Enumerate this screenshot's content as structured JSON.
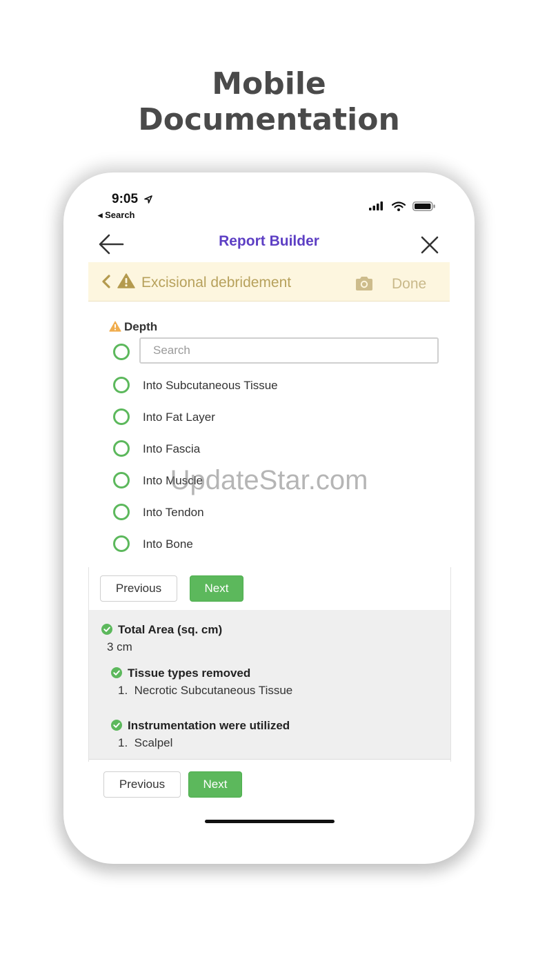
{
  "headline": {
    "line1": "Mobile",
    "line2": "Documentation"
  },
  "status_bar": {
    "time": "9:05",
    "back_label": "◂ Search"
  },
  "nav": {
    "title": "Report Builder"
  },
  "banner": {
    "title": "Excisional debridement",
    "done_label": "Done"
  },
  "depth": {
    "label": "Depth",
    "search_placeholder": "Search",
    "options": [
      "Into Subcutaneous Tissue",
      "Into Fat Layer",
      "Into Fascia",
      "Into Muscle",
      "Into Tendon",
      "Into Bone"
    ]
  },
  "buttons": {
    "previous": "Previous",
    "next": "Next"
  },
  "summary": {
    "items": [
      {
        "title": "Total Area (sq. cm)",
        "value": "3 cm"
      },
      {
        "title": "Tissue types removed",
        "value": "1.  Necrotic Subcutaneous Tissue"
      },
      {
        "title": "Instrumentation were utilized",
        "value": "1.  Scalpel"
      }
    ]
  },
  "watermark": "UpdateStar.com",
  "colors": {
    "accent": "#5d3fc4",
    "success": "#5cb85c",
    "warning": "#f0ad4e",
    "banner_bg": "#fdf6df"
  }
}
